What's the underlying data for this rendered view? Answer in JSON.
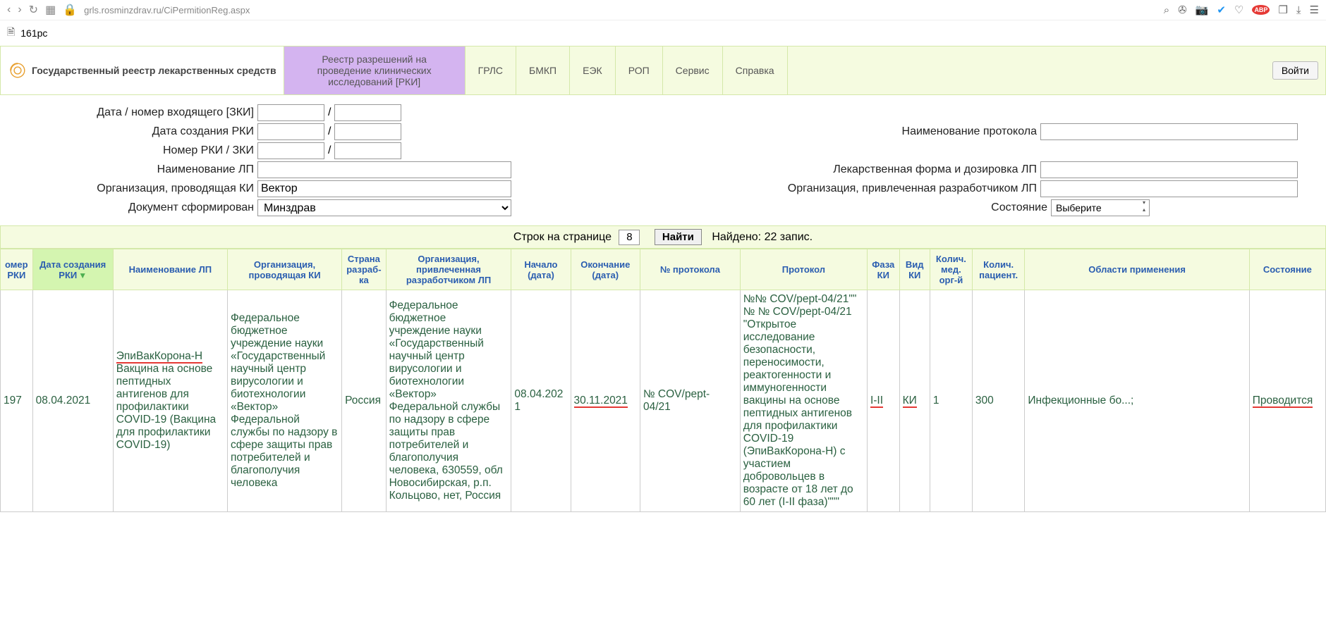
{
  "browser": {
    "url": "grls.rosminzdrav.ru/CiPermitionReg.aspx",
    "tab_title": "161pc"
  },
  "header": {
    "logo_text": "Государственный реестр лекарственных средств",
    "nav": [
      "Реестр разрешений на проведение клинических исследований [РКИ]",
      "ГРЛС",
      "БМКП",
      "ЕЭК",
      "РОП",
      "Сервис",
      "Справка"
    ],
    "login": "Войти"
  },
  "filters": {
    "date_zki_label": "Дата / номер входящего [ЗКИ]",
    "date_rki_label": "Дата создания РКИ",
    "num_rki_label": "Номер РКИ / ЗКИ",
    "lp_name_label": "Наименование ЛП",
    "org_ki_label": "Организация, проводящая КИ",
    "doc_formed_label": "Документ сформирован",
    "protocol_name_label": "Наименование протокола",
    "form_dose_label": "Лекарственная форма и дозировка ЛП",
    "org_dev_label": "Организация, привлеченная разработчиком ЛП",
    "state_label": "Состояние",
    "org_ki_value": "Вектор",
    "doc_formed_value": "Минздрав",
    "state_value": "Выберите"
  },
  "pager": {
    "rows_label": "Строк на странице",
    "rows_value": "8",
    "find": "Найти",
    "found": "Найдено: 22 запис."
  },
  "columns": [
    "омер РКИ",
    "Дата создания РКИ",
    "Наименование ЛП",
    "Организация, проводящая КИ",
    "Страна разраб-ка",
    "Организация, привлеченная разработчиком ЛП",
    "Начало (дата)",
    "Окончание (дата)",
    "№ протокола",
    "Протокол",
    "Фаза КИ",
    "Вид КИ",
    "Колич. мед. орг-й",
    "Колич. пациент.",
    "Области применения",
    "Состояние"
  ],
  "row": {
    "num": "197",
    "date": "08.04.2021",
    "lp_name_hl": "ЭпиВакКорона-Н",
    "lp_name_rest": "Вакцина на основе пептидных антигенов для профилактики COVID-19 (Вакцина для профилактики COVID-19)",
    "org_ki": "Федеральное бюджетное учреждение науки «Государственный научный центр вирусологии и биотехнологии «Вектор» Федеральной службы по надзору в сфере защиты прав потребителей и благополучия человека",
    "country": "Россия",
    "org_dev": "Федеральное бюджетное учреждение науки «Государственный научный центр вирусологии и биотехнологии «Вектор» Федеральной службы по надзору в сфере защиты прав потребителей и благополучия человека, 630559, обл Новосибирская, р.п. Кольцово, нет, Россия",
    "start": "08.04.2021",
    "end": "30.11.2021",
    "protocol_num": "№ COV/pept-04/21",
    "protocol": "№№ COV/pept-04/21\"\" № № COV/pept-04/21 \"Открытое исследование безопасности, переносимости, реактогенности и иммуногенности вакцины на основе пептидных антигенов для профилактики COVID-19 (ЭпиВакКорона-Н) с участием добровольцев в возрасте от 18 лет до 60 лет (I-II фаза)\"\"\"",
    "phase": "I-II",
    "type": "КИ",
    "med_orgs": "1",
    "patients": "300",
    "areas": "Инфекционные бо...;",
    "state": "Проводится"
  }
}
